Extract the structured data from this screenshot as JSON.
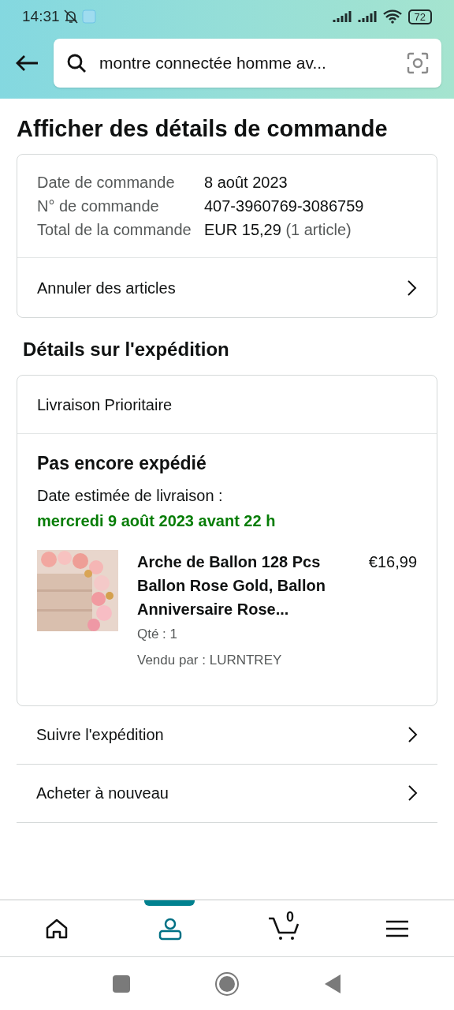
{
  "status_bar": {
    "time": "14:31",
    "battery": "72"
  },
  "search": {
    "value": "montre connectée homme av..."
  },
  "title": "Afficher des détails de commande",
  "order_summary": {
    "rows": [
      {
        "label": "Date de commande",
        "value": "8 août 2023"
      },
      {
        "label": "N° de commande",
        "value": "407-3960769-3086759"
      },
      {
        "label": "Total de la commande",
        "value": "EUR 15,29",
        "note": "(1 article)"
      }
    ],
    "action": "Annuler des articles"
  },
  "shipment_heading": "Détails sur l'expédition",
  "shipment": {
    "method": "Livraison Prioritaire",
    "status": "Pas encore expédié",
    "estimate_label": "Date estimée de livraison :",
    "estimate_date": "mercredi 9 août 2023 avant 22 h",
    "item": {
      "title": "Arche de Ballon 128 Pcs Ballon Rose Gold, Ballon Anniversaire Rose...",
      "price": "€16,99",
      "quantity": "Qté : 1",
      "seller": "Vendu par : LURNTREY"
    }
  },
  "actions": [
    "Suivre l'expédition",
    "Acheter à nouveau"
  ],
  "bottom_nav": [
    {
      "kind": "home",
      "selected": false
    },
    {
      "kind": "account",
      "selected": true
    },
    {
      "kind": "cart",
      "selected": false,
      "count": "0"
    },
    {
      "kind": "menu",
      "selected": false
    }
  ]
}
